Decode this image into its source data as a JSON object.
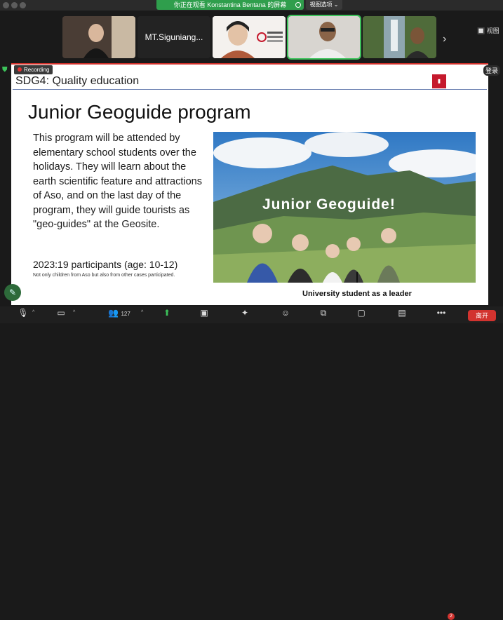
{
  "share_banner": {
    "text": "你正在观看 Konstantina Bentana 的屏幕"
  },
  "view_options": {
    "label": "视图选项 ⌄"
  },
  "view_button": {
    "label": "🔲 视图"
  },
  "participants_tiles": [
    {
      "name": ""
    },
    {
      "name": "MT.Siguniang..."
    },
    {
      "name": ""
    },
    {
      "name": ""
    },
    {
      "name": ""
    }
  ],
  "recording": {
    "label": "Recording"
  },
  "login_button": {
    "label": "登录"
  },
  "slide": {
    "header": "SDG4: Quality education",
    "title": "Junior Geoguide program",
    "body": "This program will be attended by elementary school students over the holidays. They will learn about the earth scientific feature and attractions of Aso, and on the last day of the program, they will guide tourists as \"geo-guides\" at the Geosite.",
    "participants": "2023:19 participants (age: 10-12)",
    "note": "Not only children from Aso but also from other cases participated.",
    "photo_caption": "Junior Geoguide!",
    "leader_label": "University student as a leader"
  },
  "toolbar": {
    "participant_count": "127",
    "chat_badge": "2",
    "leave_label": "离开"
  },
  "colors": {
    "accent_green": "#3cc25a",
    "leave_red": "#d2332f",
    "sdg_red": "#c5192d"
  }
}
